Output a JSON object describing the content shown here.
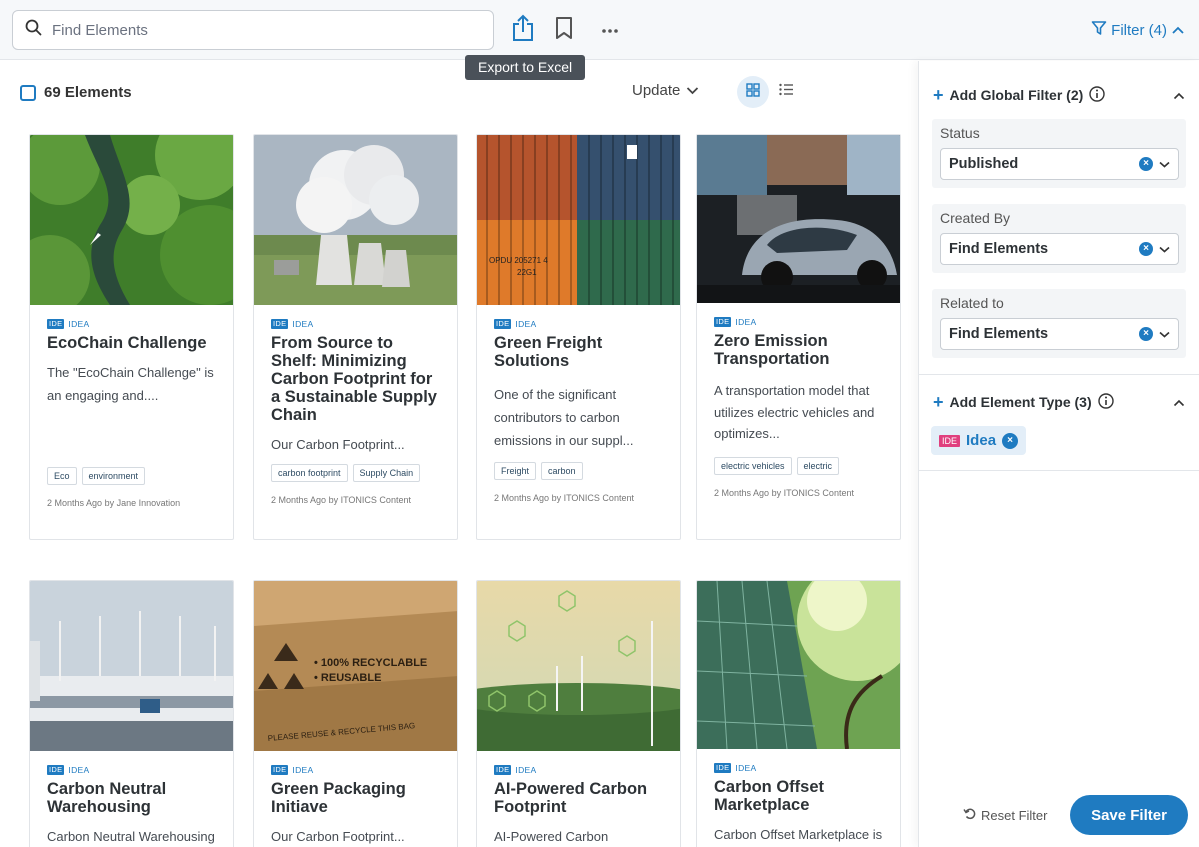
{
  "toolbar": {
    "search_placeholder": "Find Elements",
    "tooltip": "Export to Excel",
    "filter_label": "Filter (4)"
  },
  "list": {
    "count_label": "69 Elements",
    "sort_label": "Update"
  },
  "colors": {
    "accent": "#1f7bc1",
    "idea_badge": "#e03f7e"
  },
  "cards": [
    {
      "badge": "IDE",
      "type": "IDEA",
      "title": "EcoChain Challenge",
      "desc": "The \"EcoChain Challenge\" is an engaging and....",
      "tags": [
        "Eco",
        "environment"
      ],
      "meta_time": "2 Months Ago",
      "meta_by": "by",
      "meta_author": "Jane Innovation"
    },
    {
      "badge": "IDE",
      "type": "IDEA",
      "title": "From Source to Shelf: Minimizing Carbon Footprint for a Sustainable Supply Chain",
      "desc": "Our Carbon Footprint...",
      "tags": [
        "carbon footprint",
        "Supply Chain"
      ],
      "meta_time": "2 Months Ago",
      "meta_by": "by",
      "meta_author": "ITONICS Content"
    },
    {
      "badge": "IDE",
      "type": "IDEA",
      "title": "Green Freight Solutions",
      "desc": "One of the significant contributors to carbon emissions in our suppl...",
      "tags": [
        "Freight",
        "carbon"
      ],
      "meta_time": "2 Months Ago",
      "meta_by": "by",
      "meta_author": "ITONICS Content"
    },
    {
      "badge": "IDE",
      "type": "IDEA",
      "title": "Zero Emission Transportation",
      "desc": "A transportation model that utilizes electric vehicles and optimizes...",
      "tags": [
        "electric vehicles",
        "electric"
      ],
      "meta_time": "2 Months Ago",
      "meta_by": "by",
      "meta_author": "ITONICS Content"
    },
    {
      "badge": "IDE",
      "type": "IDEA",
      "title": "Carbon Neutral Warehousing",
      "desc": "Carbon Neutral Warehousing",
      "tags": [],
      "meta_time": "",
      "meta_by": "",
      "meta_author": ""
    },
    {
      "badge": "IDE",
      "type": "IDEA",
      "title": "Green Packaging Initiave",
      "desc": "Our Carbon Footprint...",
      "tags": [],
      "meta_time": "",
      "meta_by": "",
      "meta_author": ""
    },
    {
      "badge": "IDE",
      "type": "IDEA",
      "title": "AI-Powered Carbon Footprint",
      "desc": "AI-Powered Carbon Footprint",
      "tags": [],
      "meta_time": "",
      "meta_by": "",
      "meta_author": ""
    },
    {
      "badge": "IDE",
      "type": "IDEA",
      "title": "Carbon Offset Marketplace",
      "desc": "Carbon Offset Marketplace is",
      "tags": [],
      "meta_time": "",
      "meta_by": "",
      "meta_author": ""
    }
  ],
  "image_text": {
    "container_code": "OPDU 205271 4",
    "container_code2": "22G1",
    "pack_line1": "• 100% RECYCLABLE",
    "pack_line2": "• REUSABLE",
    "pack_line3": "PLEASE REUSE & RECYCLE THIS BAG"
  },
  "panel": {
    "global_filter_label": "Add Global Filter (2)",
    "filters": [
      {
        "label": "Status",
        "value": "Published"
      },
      {
        "label": "Created By",
        "value": "Find Elements"
      },
      {
        "label": "Related to",
        "value": "Find Elements"
      }
    ],
    "element_type_label": "Add Element Type (3)",
    "chip_badge": "IDE",
    "chip_label": "Idea",
    "reset_label": "Reset Filter",
    "save_label": "Save Filter"
  }
}
